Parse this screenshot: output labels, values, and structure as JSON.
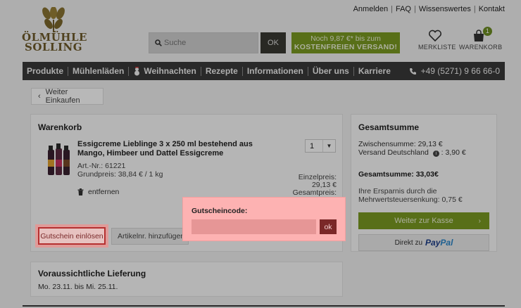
{
  "header": {
    "top_links": [
      "Anmelden",
      "FAQ",
      "Wissenswertes",
      "Kontakt"
    ],
    "logo_line1": "ÖLMÜHLE",
    "logo_line2": "SOLLING",
    "search": {
      "placeholder": "Suche",
      "button": "OK"
    },
    "shipping_line1": "Noch 9,87 €* bis zum",
    "shipping_line2": "KOSTENFREIEN VERSAND!",
    "wishlist_label": "MERKLISTE",
    "cart_label": "WARENKORB",
    "cart_count": "1"
  },
  "nav": {
    "items": [
      "Produkte",
      "Mühlenläden",
      "Weihnachten",
      "Rezepte",
      "Informationen",
      "Über uns",
      "Karriere"
    ],
    "phone": "+49 (5271) 9 66 66-0"
  },
  "back_label": "Weiter Einkaufen",
  "cart": {
    "title": "Warenkorb",
    "product": {
      "name": "Essigcreme Lieblinge 3 x 250 ml bestehend aus Mango, Himbeer und Dattel Essigcreme",
      "article": "Art.-Nr.: 61221",
      "base_price": "Grundpreis: 38,84 € / 1 kg",
      "quantity": "1",
      "unit_price_label": "Einzelpreis:",
      "unit_price": "29,13 €",
      "total_label": "Gesamtpreis:"
    },
    "remove_label": "entfernen",
    "coupon_button": "Gutschein einlösen",
    "article_button": "Artikelnr. hinzufügen"
  },
  "summary": {
    "title": "Gesamtsumme",
    "subtotal": "Zwischensumme: 29,13 €",
    "shipping": "Versand Deutschland",
    "shipping_value": ": 3,90 €",
    "total": "Gesamtsumme: 33,03€",
    "saving": "Ihre Ersparnis durch die Mehrwertsteuersenkung: 0,75 €",
    "checkout": "Weiter zur Kasse",
    "paypal_prefix": "Direkt zu",
    "paypal_brand_a": "Pay",
    "paypal_brand_b": "Pal"
  },
  "delivery": {
    "title": "Voraussichtliche Lieferung",
    "dates": "Mo. 23.11. bis Mi. 25.11."
  },
  "popup": {
    "label": "Gutscheincode:",
    "value": "",
    "ok": "ok"
  },
  "colors": {
    "accent_green": "#7a9a22",
    "nav_dark": "#393939",
    "popup_bg": "#fdb2b2",
    "popup_button": "#7a2828"
  }
}
